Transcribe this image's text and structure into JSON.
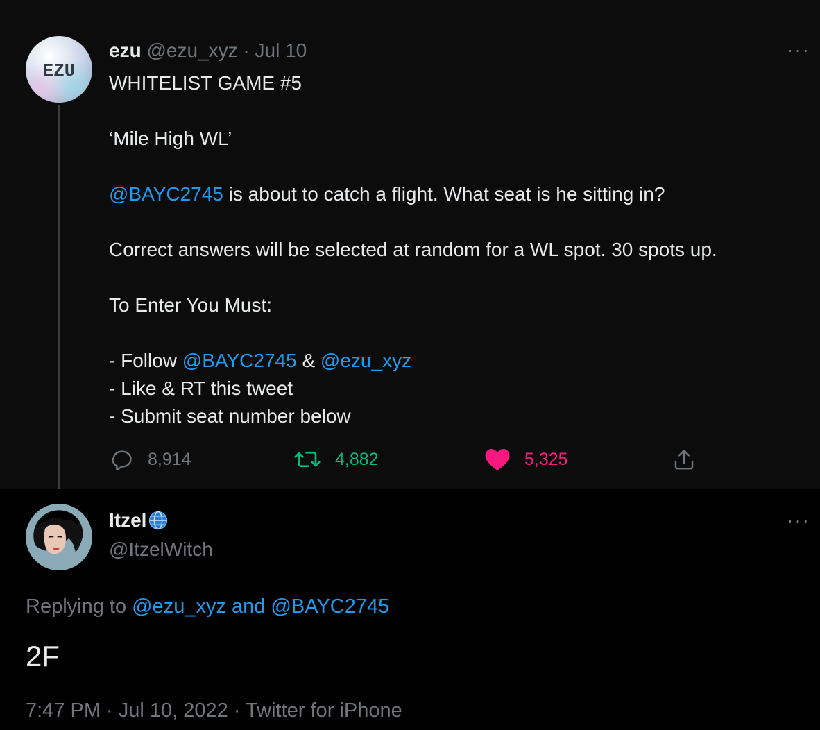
{
  "tweet": {
    "author_name": "ezu",
    "author_handle": "@ezu_xyz",
    "separator": "·",
    "date": "Jul 10",
    "avatar_text": "EZU",
    "more_label": "···",
    "lines": {
      "title": "WHITELIST GAME #5",
      "subtitle": "‘Mile High WL’",
      "mention": "@BAYC2745",
      "question": " is about to catch a flight. What seat is he sitting in?",
      "correct": "Correct answers will be selected at random for a WL spot. 30 spots up.",
      "enter": "To Enter You Must:",
      "follow_prefix": "- Follow ",
      "follow_mention1": "@BAYC2745",
      "follow_amp": " & ",
      "follow_mention2": "@ezu_xyz",
      "like_rt": "- Like & RT this tweet",
      "submit": "- Submit seat number below"
    },
    "actions": {
      "replies": "8,914",
      "retweets": "4,882",
      "likes": "5,325"
    }
  },
  "reply": {
    "author_name": "Itzel",
    "author_handle": "@ItzelWitch",
    "more_label": "···",
    "replying_prefix": "Replying to ",
    "replying_user1": "@ezu_xyz",
    "replying_and": " and ",
    "replying_user2": "@BAYC2745",
    "text": "2F",
    "time": "7:47 PM",
    "separator1": " · ",
    "date": "Jul 10, 2022",
    "separator2": " · ",
    "source": "Twitter for iPhone"
  },
  "colors": {
    "link": "#1d9bf0",
    "retweet": "#00ba7c",
    "like": "#f91880",
    "muted": "#71767b"
  }
}
